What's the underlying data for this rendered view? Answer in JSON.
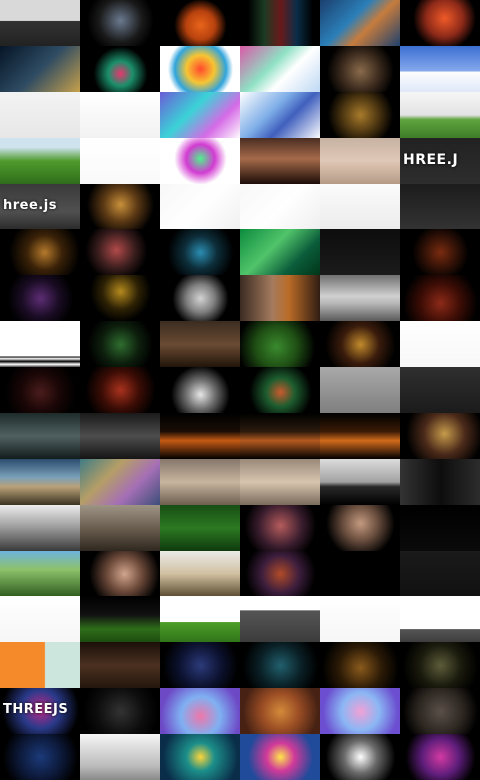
{
  "gallery": {
    "tiles": [
      {
        "id": "r0c0",
        "bg": "linear-gradient(#d9d9d9 0%,#d9d9d9 45%,#333 46%,#222 100%)",
        "label": ""
      },
      {
        "id": "r0c1",
        "bg": "radial-gradient(circle at 50% 45%,#6b7a8f 0%,#1a1a1a 45%,#000 70%)",
        "label": ""
      },
      {
        "id": "r0c2",
        "bg": "radial-gradient(circle at 50% 55%,#e8641a 0%,#b8420e 30%,#000 55%)",
        "label": ""
      },
      {
        "id": "r0c3",
        "bg": "linear-gradient(90deg,#000 10%,#1b3b23 30%,#6a1a1a 50%,#0a2d48 70%,#000 90%)",
        "label": ""
      },
      {
        "id": "r0c4",
        "bg": "linear-gradient(135deg,#1b3f6e 0%,#2b7fb8 40%,#c67c3d 60%,#1b3f6e 100%)",
        "label": ""
      },
      {
        "id": "r0c5",
        "bg": "radial-gradient(circle at 55% 40%,#f05a28 0%,#8e2a19 35%,#000 60%)",
        "label": ""
      },
      {
        "id": "r1c0",
        "bg": "linear-gradient(135deg,#051525 0%,#2e4b63 50%,#c9a24b 100%)",
        "label": ""
      },
      {
        "id": "r1c1",
        "bg": "radial-gradient(circle at 50% 60%,#e7366f 0%,#1b8f6a 25%,#000 55%)",
        "label": ""
      },
      {
        "id": "r1c2",
        "bg": "radial-gradient(circle at 50% 50%,#ff4a2c 0%,#f6c533 30%,#30a4dc 55%,#fff 70%)",
        "label": ""
      },
      {
        "id": "r1c3",
        "bg": "linear-gradient(135deg,#d95aa7 0%,#8fe0c4 40%,#ffffff 60%,#bcd7f3 100%)",
        "label": ""
      },
      {
        "id": "r1c4",
        "bg": "radial-gradient(circle at 50% 55%,#8a6b4c 0%,#3b2a1d 40%,#000 70%)",
        "label": ""
      },
      {
        "id": "r1c5",
        "bg": "linear-gradient(#3c6fd2 0%,#86a9ec 55%,#fdfdfd 56%,#dfe8f9 100%)",
        "label": ""
      },
      {
        "id": "r2c0",
        "bg": "linear-gradient(#f3f3f3,#e7e7e7)",
        "label": ""
      },
      {
        "id": "r2c1",
        "bg": "linear-gradient(#ffffff,#f2f2f2)",
        "label": ""
      },
      {
        "id": "r2c2",
        "bg": "linear-gradient(135deg,#6b5cd6 0%,#3bd3d7 40%,#d56ae6 70%,#ffffff 100%)",
        "label": ""
      },
      {
        "id": "r2c3",
        "bg": "linear-gradient(135deg,#ffffff 0%,#7faee8 40%,#3f5fbd 60%,#ffffff 100%)",
        "label": ""
      },
      {
        "id": "r2c4",
        "bg": "radial-gradient(circle at 50% 50%,#a87b2b 0%,#4a3410 40%,#000 70%)",
        "label": ""
      },
      {
        "id": "r2c5",
        "bg": "linear-gradient(#f6f6f6 0%,#e3e3e3 50%,#5ea43e 60%,#3f7d29 100%)",
        "label": ""
      },
      {
        "id": "r3c0",
        "bg": "linear-gradient(#cfe3ee 0%,#cfe3ee 20%,#4f9b2d 50%,#2e6c1b 100%)",
        "label": ""
      },
      {
        "id": "r3c1",
        "bg": "linear-gradient(#ffffff,#fafafa)",
        "label": ""
      },
      {
        "id": "r3c2",
        "bg": "radial-gradient(circle at 50% 45%,#4ef28b 0%,#d23bd2 30%,#ffffff 55%)",
        "label": ""
      },
      {
        "id": "r3c3",
        "bg": "linear-gradient(#4b2e22 0%,#a56a4a 45%,#1c0d08 100%)",
        "label": ""
      },
      {
        "id": "r3c4",
        "bg": "linear-gradient(#c7b2a2 0%,#e0c8b6 50%,#b59b86 100%)",
        "label": ""
      },
      {
        "id": "r3c5",
        "bg": "linear-gradient(#222 0%,#2d2d2d 100%)",
        "label": "HREE.J"
      },
      {
        "id": "r4c0",
        "bg": "linear-gradient(#3a3a3a 0%,#505050 60%,#2a2a2a 100%)",
        "label": "hree.js"
      },
      {
        "id": "r4c1",
        "bg": "radial-gradient(circle at 50% 45%,#c8903a 0%,#5d3a15 35%,#000 70%)",
        "label": ""
      },
      {
        "id": "r4c2",
        "bg": "linear-gradient(135deg,#f7f7f7 0%,#ffffff 50%,#f0f0f0 100%)",
        "label": ""
      },
      {
        "id": "r4c3",
        "bg": "linear-gradient(135deg,#f7f7f7 0%,#ffffff 50%,#efefef 100%)",
        "label": ""
      },
      {
        "id": "r4c4",
        "bg": "linear-gradient(#fbfbfb 0%,#ececec 100%)",
        "label": ""
      },
      {
        "id": "r4c5",
        "bg": "linear-gradient(#1c1c1c 0%,#333 100%)",
        "label": ""
      },
      {
        "id": "r5c0",
        "bg": "radial-gradient(circle at 55% 50%,#b57a2c 0%,#3a2208 35%,#000 70%)",
        "label": ""
      },
      {
        "id": "r5c1",
        "bg": "radial-gradient(circle at 45% 45%,#b14a4a 0%,#3c1e1e 35%,#000 60%)",
        "label": ""
      },
      {
        "id": "r5c2",
        "bg": "radial-gradient(circle at 50% 50%,#2b8db1 0%,#0d2e3a 35%,#000 70%)",
        "label": ""
      },
      {
        "id": "r5c3",
        "bg": "linear-gradient(135deg,#0c8b3d 0%,#51c46b 40%,#0b5c3a 70%,#003316 100%)",
        "label": ""
      },
      {
        "id": "r5c4",
        "bg": "linear-gradient(#0d0d0d,#1b1b1b)",
        "label": ""
      },
      {
        "id": "r5c5",
        "bg": "radial-gradient(circle at 50% 50%,#7a2b0f 0%,#3b1508 30%,#000 60%)",
        "label": ""
      },
      {
        "id": "r6c0",
        "bg": "radial-gradient(circle at 50% 50%,#5c2d74 0%,#1a0c24 40%,#000 70%)",
        "label": ""
      },
      {
        "id": "r6c1",
        "bg": "radial-gradient(circle at 50% 35%,#b58a1e 0%,#2e2205 35%,#000 60%)",
        "label": ""
      },
      {
        "id": "r6c2",
        "bg": "radial-gradient(circle at 50% 50%,#d3d3d3 0%,#7f7f7f 30%,#000 60%)",
        "label": ""
      },
      {
        "id": "r6c3",
        "bg": "linear-gradient(90deg,#3b2b22 0%,#a47b5e 40%,#bb6c27 60%,#2b1a12 100%)",
        "label": ""
      },
      {
        "id": "r6c4",
        "bg": "linear-gradient(#6f6f6f 0%,#d0d0d0 45%,#b8b8b8 60%,#555 100%)",
        "label": ""
      },
      {
        "id": "r6c5",
        "bg": "radial-gradient(circle at 50% 60%,#8c2a18 0%,#3d0d05 40%,#000 75%)",
        "label": ""
      },
      {
        "id": "r7c0",
        "bg": "linear-gradient(#ffffff 0%,#ffffff 75%,#000 76%,#fff 80%,#000 86%,#fff 92%,#000 100%)",
        "label": ""
      },
      {
        "id": "r7c1",
        "bg": "radial-gradient(circle at 50% 50%,#2f6d2f 0%,#0d1f0d 40%,#000 70%)",
        "label": ""
      },
      {
        "id": "r7c2",
        "bg": "linear-gradient(#3b2c20 0%,#6a4b33 50%,#1e1208 100%)",
        "label": ""
      },
      {
        "id": "r7c3",
        "bg": "radial-gradient(circle at 45% 55%,#3a8a2e 0%,#1f4f14 40%,#000 75%)",
        "label": ""
      },
      {
        "id": "r7c4",
        "bg": "radial-gradient(circle at 50% 50%,#c28b2c 0%,#3a1c0c 40%,#000 75%)",
        "label": ""
      },
      {
        "id": "r7c5",
        "bg": "linear-gradient(#ffffff,#f7f7f7)",
        "label": ""
      },
      {
        "id": "r8c0",
        "bg": "radial-gradient(circle at 50% 55%,#4b1c1c 0%,#1a0606 40%,#000 75%)",
        "label": ""
      },
      {
        "id": "r8c1",
        "bg": "radial-gradient(circle at 50% 50%,#a9321e 0%,#3d0d05 40%,#000 75%)",
        "label": ""
      },
      {
        "id": "r8c2",
        "bg": "radial-gradient(circle at 50% 60%,#e7e7e7 0%,#6d6d6d 30%,#000 60%)",
        "label": ""
      },
      {
        "id": "r8c3",
        "bg": "radial-gradient(circle at 50% 55%,#c95a2e 0%,#1d5d2f 30%,#000 65%)",
        "label": ""
      },
      {
        "id": "r8c4",
        "bg": "linear-gradient(#a9a9a9,#7f7f7f)",
        "label": ""
      },
      {
        "id": "r8c5",
        "bg": "linear-gradient(#2f2f2f,#1b1b1b)",
        "label": ""
      },
      {
        "id": "r9c0",
        "bg": "linear-gradient(#1e2b2b 0%,#506060 50%,#121b1b 100%)",
        "label": ""
      },
      {
        "id": "r9c1",
        "bg": "linear-gradient(#1a1a1a 0%,#4d4d4d 50%,#151515 100%)",
        "label": ""
      },
      {
        "id": "r9c2",
        "bg": "linear-gradient(#000 0%,#1a0d05 40%,#c45a13 60%,#000 100%)",
        "label": ""
      },
      {
        "id": "r9c3",
        "bg": "linear-gradient(#000 0%,#2a1a0d 40%,#b45a1f 60%,#000 100%)",
        "label": ""
      },
      {
        "id": "r9c4",
        "bg": "linear-gradient(#000 0%,#3a1a05 40%,#d16b1c 60%,#000 100%)",
        "label": ""
      },
      {
        "id": "r9c5",
        "bg": "radial-gradient(circle at 55% 45%,#c69b4b 0%,#4b2a1a 40%,#000 75%)",
        "label": ""
      },
      {
        "id": "r10c0",
        "bg": "linear-gradient(#2b4c6d 0%,#7aa0b8 40%,#b8a178 60%,#3c3322 100%)",
        "label": ""
      },
      {
        "id": "r10c1",
        "bg": "linear-gradient(135deg,#3e7c84 0%,#b59e67 35%,#a56fb5 65%,#3a4d78 100%)",
        "label": ""
      },
      {
        "id": "r10c2",
        "bg": "linear-gradient(#86776b 0%,#c8b59e 50%,#6d5e4f 100%)",
        "label": ""
      },
      {
        "id": "r10c3",
        "bg": "linear-gradient(#998979 0%,#d7c5af 50%,#7b6b5b 100%)",
        "label": ""
      },
      {
        "id": "r10c4",
        "bg": "linear-gradient(#dcdcdc 0%,#a2a2a2 50%,#292929 60%,#000 100%)",
        "label": ""
      },
      {
        "id": "r10c5",
        "bg": "linear-gradient(90deg,#333 0%,#0d0d0d 50%,#2d2d2d 100%)",
        "label": ""
      },
      {
        "id": "r11c0",
        "bg": "linear-gradient(#ededed 0%,#999 50%,#3a3a3a 100%)",
        "label": ""
      },
      {
        "id": "r11c1",
        "bg": "linear-gradient(#9e9485 0%,#6a5e4f 50%,#2f281f 100%)",
        "label": ""
      },
      {
        "id": "r11c2",
        "bg": "linear-gradient(#184d14 0%,#2c7a22 50%,#0f3a0d 100%)",
        "label": ""
      },
      {
        "id": "r11c3",
        "bg": "radial-gradient(circle at 50% 45%,#b55c5c 0%,#3a1d2e 45%,#000 75%)",
        "label": ""
      },
      {
        "id": "r11c4",
        "bg": "radial-gradient(circle at 50% 40%,#c49a80 0%,#6b4f3f 35%,#000 70%)",
        "label": ""
      },
      {
        "id": "r11c5",
        "bg": "linear-gradient(#000,#0a0a0a)",
        "label": ""
      },
      {
        "id": "r12c0",
        "bg": "linear-gradient(#6db4dd 0%,#8ec26b 40%,#2d5b1e 100%)",
        "label": ""
      },
      {
        "id": "r12c1",
        "bg": "radial-gradient(circle at 55% 50%,#d2a58e 0%,#6d4a3a 35%,#000 70%)",
        "label": ""
      },
      {
        "id": "r12c2",
        "bg": "linear-gradient(#eaeaea 0%,#d0c0a0 50%,#5a4a30 100%)",
        "label": ""
      },
      {
        "id": "r12c3",
        "bg": "radial-gradient(circle at 50% 50%,#b04b28 0%,#3d1e3d 40%,#000 75%)",
        "label": ""
      },
      {
        "id": "r12c4",
        "bg": "linear-gradient(#000,#000)",
        "label": ""
      },
      {
        "id": "r12c5",
        "bg": "linear-gradient(#1a1a1a,#111)",
        "label": ""
      },
      {
        "id": "r13c0",
        "bg": "linear-gradient(#ffffff,#f6f6f6)",
        "label": ""
      },
      {
        "id": "r13c1",
        "bg": "linear-gradient(#000 0%,#111 40%,#2e6d1a 70%,#1c4a0e 100%)",
        "label": ""
      },
      {
        "id": "r13c2",
        "bg": "linear-gradient(#ffffff 0%,#ffffff 55%,#4c9e2a 56%,#2f7318 100%)",
        "label": ""
      },
      {
        "id": "r13c3",
        "bg": "linear-gradient(#ffffff 0%,#ffffff 30%,#555 31%,#3b3b3b 100%)",
        "label": ""
      },
      {
        "id": "r13c4",
        "bg": "linear-gradient(#ffffff,#f6f6f6)",
        "label": ""
      },
      {
        "id": "r13c5",
        "bg": "linear-gradient(#ffffff 0%,#ffffff 70%,#555 71%,#3b3b3b 100%)",
        "label": ""
      },
      {
        "id": "r14c0",
        "bg": "linear-gradient(90deg,#f58a2a 0%,#f58a2a 55%,#cce6dd 56%,#cce6dd 100%)",
        "label": ""
      },
      {
        "id": "r14c1",
        "bg": "linear-gradient(#1a0f08 0%,#4b3121 50%,#22150c 100%)",
        "label": ""
      },
      {
        "id": "r14c2",
        "bg": "radial-gradient(circle at 50% 50%,#2c3a7a 0%,#0c1230 45%,#000 80%)",
        "label": ""
      },
      {
        "id": "r14c3",
        "bg": "radial-gradient(circle at 50% 50%,#215f6d 0%,#0a2026 45%,#000 80%)",
        "label": ""
      },
      {
        "id": "r14c4",
        "bg": "radial-gradient(circle at 50% 55%,#8a5a1c 0%,#2b1a06 45%,#000 80%)",
        "label": ""
      },
      {
        "id": "r14c5",
        "bg": "radial-gradient(circle at 50% 50%,#5c5c3a 0%,#1a1a0d 45%,#000 80%)",
        "label": ""
      },
      {
        "id": "r15c0",
        "bg": "radial-gradient(circle at 50% 45%,#c02a8a 0%,#2a3a8a 40%,#000 80%)",
        "label": "THREEJS"
      },
      {
        "id": "r15c1",
        "bg": "radial-gradient(circle at 50% 50%,#333 0%,#0d0d0d 50%,#000 80%)",
        "label": ""
      },
      {
        "id": "r15c2",
        "bg": "radial-gradient(circle at 50% 60%,#ee77aa 0%,#7fb0f2 40%,#6d49c6 80%)",
        "label": ""
      },
      {
        "id": "r15c3",
        "bg": "radial-gradient(circle at 50% 50%,#d38b3a 0%,#9a4d24 40%,#472214 80%)",
        "label": ""
      },
      {
        "id": "r15c4",
        "bg": "radial-gradient(circle at 50% 50%,#f0a1d6 0%,#8bb7f4 40%,#6b4fd0 80%)",
        "label": ""
      },
      {
        "id": "r15c5",
        "bg": "radial-gradient(circle at 50% 50%,#5a5048 0%,#2a241f 50%,#000 80%)",
        "label": ""
      },
      {
        "id": "r16c0",
        "bg": "radial-gradient(circle at 50% 50%,#1b3a7a 0%,#0b1633 50%,#000 80%)",
        "label": ""
      },
      {
        "id": "r16c1",
        "bg": "linear-gradient(#f5f5f5 0%,#bbbbbb 70%,#888 100%)",
        "label": ""
      },
      {
        "id": "r16c2",
        "bg": "radial-gradient(circle at 50% 50%,#fcd53a 0%,#1c8f8a 30%,#0a2e4a 80%)",
        "label": ""
      },
      {
        "id": "r16c3",
        "bg": "radial-gradient(circle at 50% 50%,#ffe54a 0%,#d03a9a 30%,#204a9a 70%)",
        "label": ""
      },
      {
        "id": "r16c4",
        "bg": "radial-gradient(circle at 50% 50%,#ffffff 0%,#6a6a6a 35%,#000 75%)",
        "label": ""
      },
      {
        "id": "r16c5",
        "bg": "radial-gradient(circle at 50% 50%,#d23aa2 0%,#5d1d7a 40%,#000 75%)",
        "label": ""
      }
    ]
  }
}
